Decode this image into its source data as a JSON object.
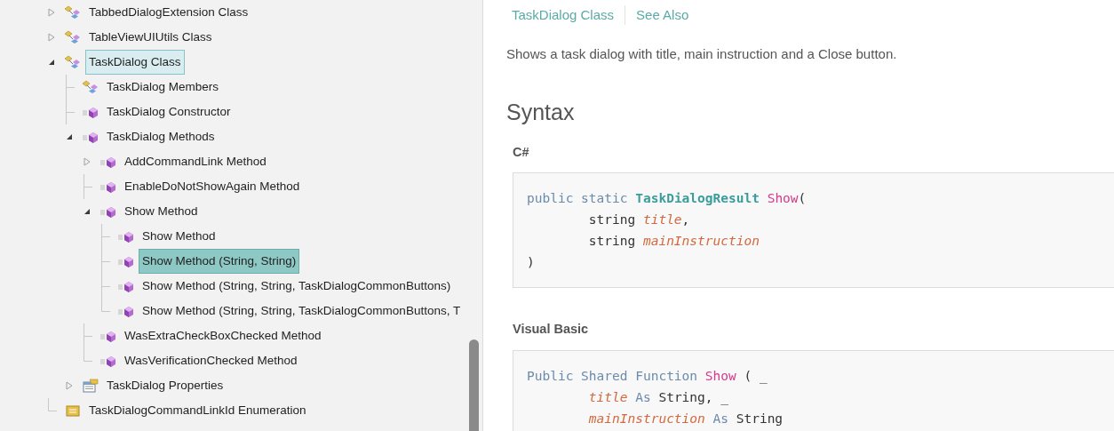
{
  "tree": [
    {
      "label": "TabbedDialogExtension Class",
      "kind": "class",
      "expanded": false,
      "selected": false,
      "highlighted": false
    },
    {
      "label": "TableViewUIUtils Class",
      "kind": "class",
      "expanded": false,
      "selected": false,
      "highlighted": false
    },
    {
      "label": "TaskDialog Class",
      "kind": "class",
      "expanded": true,
      "selected": false,
      "highlighted": true,
      "children": [
        {
          "label": "TaskDialog Members",
          "kind": "class",
          "selected": false,
          "highlighted": false
        },
        {
          "label": "TaskDialog Constructor",
          "kind": "method",
          "selected": false,
          "highlighted": false
        },
        {
          "label": "TaskDialog Methods",
          "kind": "method",
          "expanded": true,
          "selected": false,
          "highlighted": false,
          "children": [
            {
              "label": "AddCommandLink Method",
              "kind": "method",
              "expanded": false,
              "selected": false,
              "highlighted": false
            },
            {
              "label": "EnableDoNotShowAgain Method",
              "kind": "method",
              "selected": false,
              "highlighted": false
            },
            {
              "label": "Show Method",
              "kind": "method",
              "expanded": true,
              "selected": false,
              "highlighted": false,
              "children": [
                {
                  "label": "Show Method",
                  "kind": "method",
                  "selected": false,
                  "highlighted": false
                },
                {
                  "label": "Show Method (String, String)",
                  "kind": "method",
                  "selected": true,
                  "highlighted": false
                },
                {
                  "label": "Show Method (String, String, TaskDialogCommonButtons)",
                  "kind": "method",
                  "selected": false,
                  "highlighted": false
                },
                {
                  "label": "Show Method (String, String, TaskDialogCommonButtons, T",
                  "kind": "method",
                  "selected": false,
                  "highlighted": false
                }
              ]
            },
            {
              "label": "WasExtraCheckBoxChecked Method",
              "kind": "method",
              "selected": false,
              "highlighted": false
            },
            {
              "label": "WasVerificationChecked Method",
              "kind": "method",
              "selected": false,
              "highlighted": false
            }
          ]
        },
        {
          "label": "TaskDialog Properties",
          "kind": "properties",
          "expanded": false,
          "selected": false,
          "highlighted": false
        }
      ]
    },
    {
      "label": "TaskDialogCommandLinkId Enumeration",
      "kind": "enumeration",
      "selected": false,
      "highlighted": false
    }
  ],
  "content": {
    "links": [
      "TaskDialog Class",
      "See Also"
    ],
    "description": "Shows a task dialog with title, main instruction and a Close button.",
    "heading": "Syntax",
    "code_blocks": [
      {
        "language": "C#",
        "lines": [
          {
            "indented": false,
            "tokens": [
              {
                "text": "public static",
                "kind": "keyword"
              },
              {
                "text": "TaskDialogResult",
                "kind": "type"
              },
              {
                "text": "Show",
                "kind": "method"
              },
              {
                "text": "(",
                "kind": "plain",
                "joined": true
              }
            ]
          },
          {
            "indented": true,
            "tokens": [
              {
                "text": "string",
                "kind": "plain"
              },
              {
                "text": "title",
                "kind": "param"
              },
              {
                "text": ",",
                "kind": "plain",
                "joined": true
              }
            ]
          },
          {
            "indented": true,
            "tokens": [
              {
                "text": "string",
                "kind": "plain"
              },
              {
                "text": "mainInstruction",
                "kind": "param"
              }
            ]
          },
          {
            "indented": false,
            "tokens": [
              {
                "text": ")",
                "kind": "plain"
              }
            ]
          }
        ]
      },
      {
        "language": "Visual Basic",
        "lines": [
          {
            "indented": false,
            "tokens": [
              {
                "text": "Public Shared Function",
                "kind": "keyword"
              },
              {
                "text": "Show",
                "kind": "method"
              },
              {
                "text": "( _",
                "kind": "plain"
              }
            ]
          },
          {
            "indented": true,
            "tokens": [
              {
                "text": "title",
                "kind": "param"
              },
              {
                "text": "As",
                "kind": "keyword"
              },
              {
                "text": "String, _",
                "kind": "plain"
              }
            ]
          },
          {
            "indented": true,
            "tokens": [
              {
                "text": "mainInstruction",
                "kind": "param"
              },
              {
                "text": "As",
                "kind": "keyword"
              },
              {
                "text": "String",
                "kind": "plain"
              }
            ]
          }
        ]
      }
    ]
  }
}
